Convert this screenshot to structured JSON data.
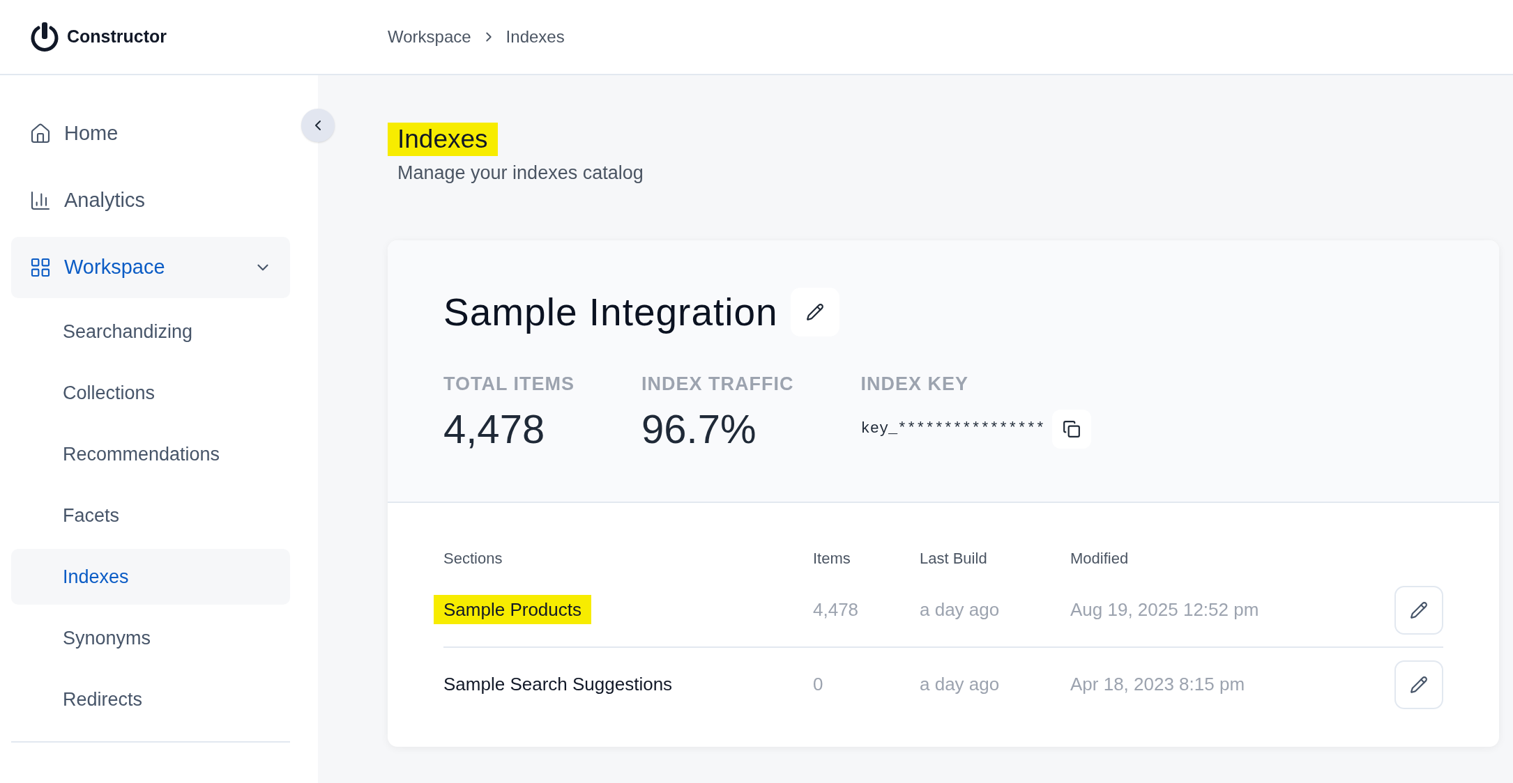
{
  "header": {
    "logo": "Constructor",
    "breadcrumbs": [
      {
        "label": "Workspace"
      },
      {
        "label": "Indexes"
      }
    ]
  },
  "sidebar": {
    "items": [
      {
        "label": "Home",
        "selected": false
      },
      {
        "label": "Analytics",
        "selected": false
      },
      {
        "label": "Workspace",
        "selected": true,
        "expanded": true,
        "children": [
          {
            "label": "Searchandizing",
            "selected": false
          },
          {
            "label": "Collections",
            "selected": false
          },
          {
            "label": "Recommendations",
            "selected": false
          },
          {
            "label": "Facets",
            "selected": false
          },
          {
            "label": "Indexes",
            "selected": true
          },
          {
            "label": "Synonyms",
            "selected": false
          },
          {
            "label": "Redirects",
            "selected": false
          }
        ]
      }
    ]
  },
  "page": {
    "title": "Indexes",
    "title_highlighted": true,
    "subtitle": "Manage your indexes catalog"
  },
  "card": {
    "title": "Sample Integration",
    "stats": [
      {
        "label": "TOTAL ITEMS",
        "value": "4,478",
        "kind": "number"
      },
      {
        "label": "INDEX TRAFFIC",
        "value": "96.7%",
        "kind": "number"
      },
      {
        "label": "INDEX KEY",
        "value": "key_****************",
        "kind": "key"
      }
    ],
    "table": {
      "columns": [
        "Sections",
        "Items",
        "Last Build",
        "Modified"
      ],
      "rows": [
        {
          "cells": [
            "Sample Products",
            "4,478",
            "a day ago",
            "Aug 19, 2025 12:52 pm"
          ],
          "highlighted": true
        },
        {
          "cells": [
            "Sample Search Suggestions",
            "0",
            "a day ago",
            "Apr 18, 2023 8:15 pm"
          ],
          "highlighted": false
        }
      ]
    }
  }
}
